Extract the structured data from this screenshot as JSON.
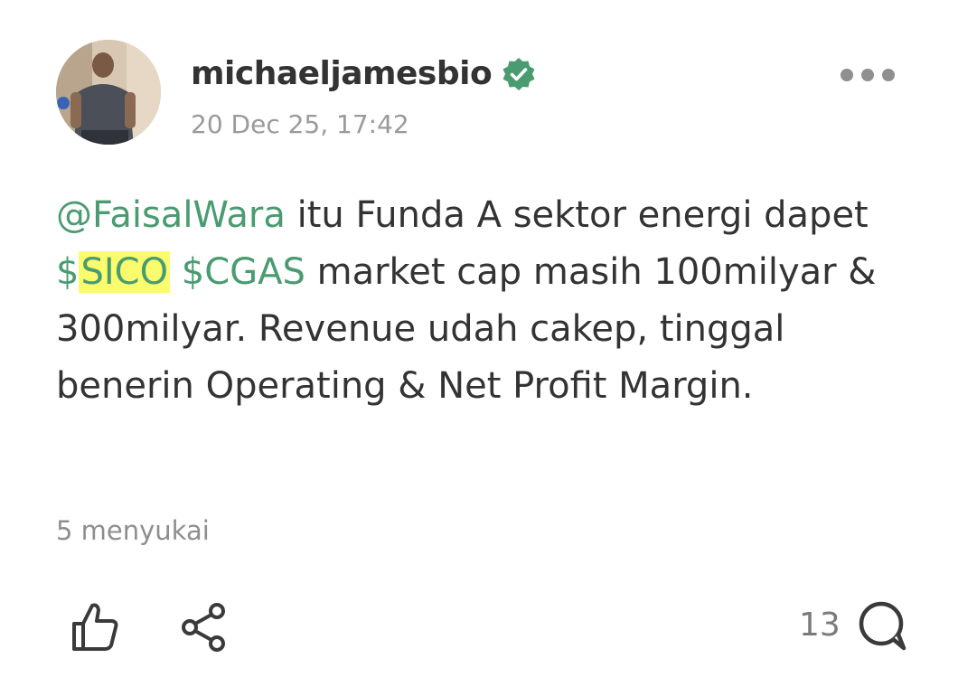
{
  "post": {
    "author": {
      "username": "michaeljamesbio",
      "verified": true,
      "avatar_icon": "avatar-photo"
    },
    "timestamp": "20 Dec 25, 17:42",
    "menu_icon": "more-horizontal-icon",
    "text": {
      "mention": "@FaisalWara",
      "part1": " itu Funda A sektor energi dapet ",
      "ticker1_dollar": "$",
      "ticker1_symbol": "SICO",
      "space": " ",
      "ticker2": "$CGAS",
      "part2": " market cap masih 100milyar & 300milyar. Revenue udah cakep, tinggal benerin Operating & Net Profit Margin."
    },
    "likes_text": "5 menyukai",
    "actions": {
      "like_icon": "thumbs-up-icon",
      "share_icon": "share-icon",
      "comment_count": "13",
      "comment_icon": "comment-icon"
    }
  },
  "colors": {
    "accent_green": "#4a9b70",
    "highlight": "#fbfb6e",
    "verified_badge": "#4a9b70",
    "muted_text": "#9a9a9a"
  }
}
